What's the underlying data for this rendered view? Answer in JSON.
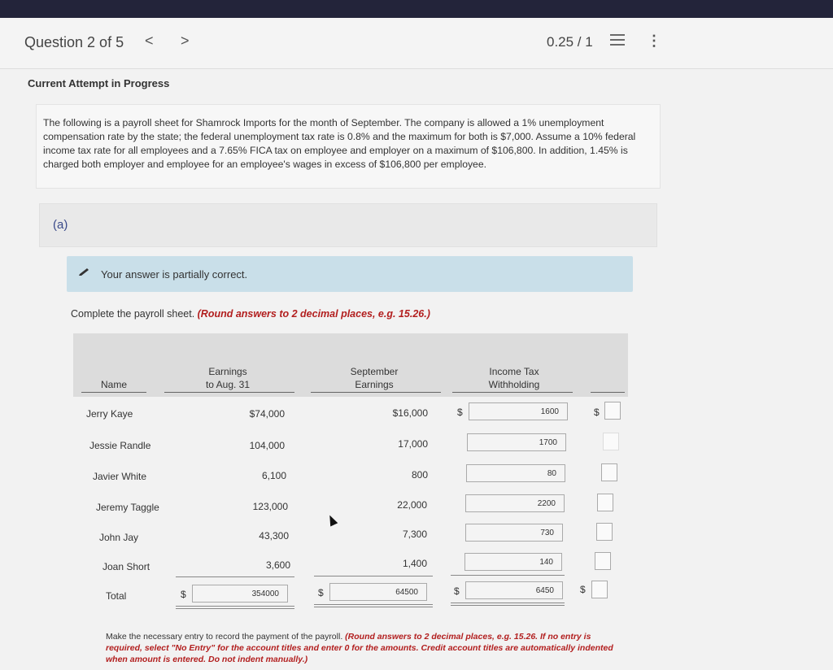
{
  "header": {
    "question_label": "Question 2 of 5",
    "prev_icon": "<",
    "next_icon": ">",
    "score": "0.25 / 1",
    "more_icon": "⋮"
  },
  "attempt_label": "Current Attempt in Progress",
  "problem_text": "The following is a payroll sheet for Shamrock Imports for the month of September. The company is allowed a 1% unemployment compensation rate by the state; the federal unemployment tax rate is 0.8% and the maximum for both is $7,000. Assume a 10% federal income tax rate for all employees and a 7.65% FICA tax on employee and employer on a maximum of $106,800. In addition, 1.45% is charged both employer and employee for an employee's wages in excess of $106,800 per employee.",
  "part_label": "(a)",
  "feedback_text": "Your answer is partially correct.",
  "instruction": {
    "text": "Complete the payroll sheet. ",
    "emphasis": "(Round answers to 2 decimal places, e.g. 15.26.)"
  },
  "table": {
    "headers": {
      "name": "Name",
      "earnings_line1": "Earnings",
      "earnings_line2": "to Aug. 31",
      "sept_line1": "September",
      "sept_line2": "Earnings",
      "tax_line1": "Income Tax",
      "tax_line2": "Withholding"
    },
    "dollar_sign": "$",
    "rows": [
      {
        "name": "Jerry Kaye",
        "earnings": "$74,000",
        "september": "$16,000",
        "withholding": "1600"
      },
      {
        "name": "Jessie Randle",
        "earnings": "104,000",
        "september": "17,000",
        "withholding": "1700"
      },
      {
        "name": "Javier White",
        "earnings": "6,100",
        "september": "800",
        "withholding": "80"
      },
      {
        "name": "Jeremy Taggle",
        "earnings": "123,000",
        "september": "22,000",
        "withholding": "2200"
      },
      {
        "name": "John Jay",
        "earnings": "43,300",
        "september": "7,300",
        "withholding": "730"
      },
      {
        "name": "Joan Short",
        "earnings": "3,600",
        "september": "1,400",
        "withholding": "140"
      }
    ],
    "total": {
      "name": "Total",
      "earnings": "354000",
      "september": "64500",
      "withholding": "6450"
    }
  },
  "footnote": {
    "text": "Make the necessary entry to record the payment of the payroll. ",
    "emphasis": "(Round answers to 2 decimal places, e.g. 15.26. If no entry is required, select \"No Entry\" for the account titles and enter 0 for the amounts. Credit account titles are automatically indented when amount is entered. Do not indent manually.)"
  }
}
